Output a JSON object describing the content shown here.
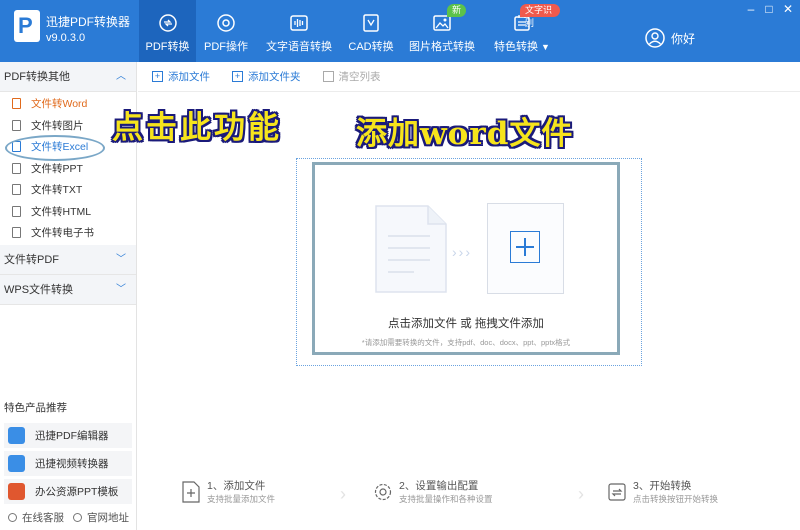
{
  "app": {
    "name": "迅捷PDF转换器",
    "version": "v9.0.3.0",
    "logo_letter": "P"
  },
  "nav": {
    "items": [
      {
        "label": "PDF转换",
        "icon": "convert-icon"
      },
      {
        "label": "PDF操作",
        "icon": "gear-icon"
      },
      {
        "label": "文字语音转换",
        "icon": "audio-wave-icon"
      },
      {
        "label": "CAD转换",
        "icon": "cad-icon"
      },
      {
        "label": "图片格式转换",
        "icon": "image-icon"
      },
      {
        "label": "特色转换",
        "icon": "special-icon"
      }
    ],
    "badge_new": "新",
    "badge_ocr": "文字识别",
    "caret": "▼"
  },
  "user": {
    "label": "你好"
  },
  "window": {
    "minimize": "–",
    "restore": "□",
    "close": "✕"
  },
  "sidebar": {
    "section1": "PDF转换其他",
    "items": [
      "文件转Word",
      "文件转图片",
      "文件转Excel",
      "文件转PPT",
      "文件转TXT",
      "文件转HTML",
      "文件转电子书"
    ],
    "section2": "文件转PDF",
    "section3": "WPS文件转换",
    "chev_up": "︿",
    "chev_down": "﹀",
    "featured_title": "特色产品推荐",
    "featured": [
      "迅捷PDF编辑器",
      "迅捷视频转换器",
      "办公资源PPT模板"
    ],
    "footer_service": "在线客服",
    "footer_site": "官网地址"
  },
  "toolbar": {
    "add_file": "添加文件",
    "add_folder": "添加文件夹",
    "clear_list": "清空列表"
  },
  "dropzone": {
    "arrows": "›››",
    "main_text": "点击添加文件 或 拖拽文件添加",
    "sub_text": "*请添加需要转换的文件，支持pdf、doc、docx、ppt、pptx格式"
  },
  "annotations": {
    "left": "点击此功能",
    "right": "添加word文件"
  },
  "steps": [
    {
      "title": "1、添加文件",
      "desc": "支持批量添加文件"
    },
    {
      "title": "2、设置输出配置",
      "desc": "支持批量操作和各种设置"
    },
    {
      "title": "3、开始转换",
      "desc": "点击转换按钮开始转换"
    }
  ],
  "colors": {
    "brand": "#2b7bd6",
    "active_nav": "#1d65bd",
    "highlight": "#e06a1c",
    "annotation_fill": "#f6e41c",
    "annotation_stroke": "#1a1a7a"
  }
}
